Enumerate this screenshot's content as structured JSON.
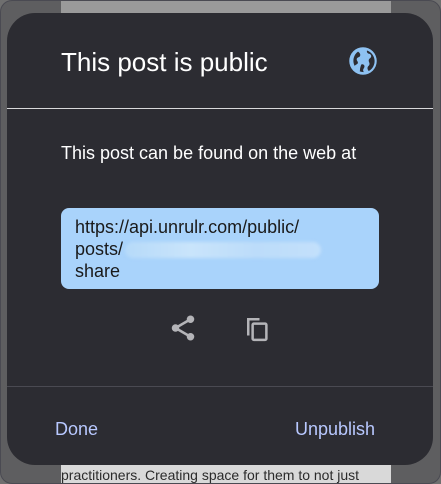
{
  "dialog": {
    "title": "This post is public",
    "description": "This post can be found on the web at",
    "url": {
      "line1": "https://api.unrulr.com/public/",
      "line2": "posts/",
      "line3": "share"
    },
    "icons": {
      "title": "globe-icon",
      "share": "share-icon",
      "copy": "copy-icon"
    },
    "actions": {
      "done_label": "Done",
      "unpublish_label": "Unpublish"
    }
  },
  "background": {
    "bottom_text": "practitioners. Creating space for them to not just"
  },
  "colors": {
    "dialog_bg": "#2c2c32",
    "url_box_bg": "#a9d3fb",
    "action_text": "#b8c8ff",
    "globe": "#8ec2f2",
    "icon_gray": "#b4b4b8"
  }
}
